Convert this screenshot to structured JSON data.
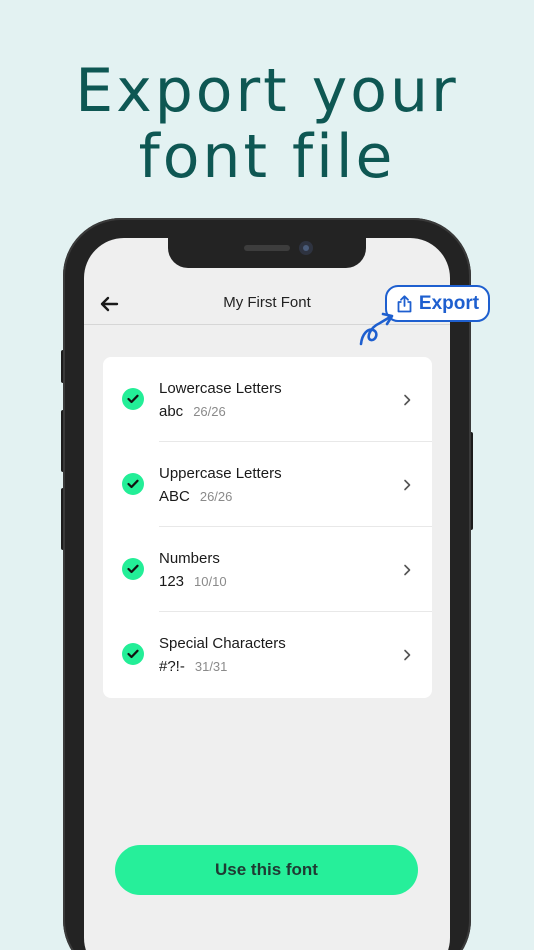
{
  "headline": {
    "line1": "Export your",
    "line2": "font file"
  },
  "nav": {
    "title": "My First Font",
    "back_icon": "arrow-left-icon"
  },
  "export": {
    "label": "Export",
    "icon": "share-icon"
  },
  "categories": [
    {
      "title": "Lowercase Letters",
      "sample": "abc",
      "count": "26/26"
    },
    {
      "title": "Uppercase Letters",
      "sample": "ABC",
      "count": "26/26"
    },
    {
      "title": "Numbers",
      "sample": "123",
      "count": "10/10"
    },
    {
      "title": "Special Characters",
      "sample": "#?!-",
      "count": "31/31"
    }
  ],
  "cta": {
    "label": "Use this font"
  },
  "colors": {
    "background": "#e3f2f2",
    "headline": "#0e5753",
    "accent_green": "#26ef9a",
    "export_blue": "#1e5fcf"
  }
}
